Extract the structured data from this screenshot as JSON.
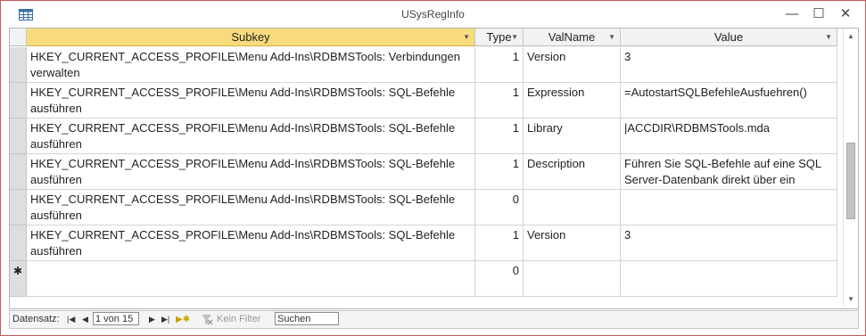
{
  "window": {
    "title": "USysRegInfo",
    "minimize": "—",
    "maximize": "☐",
    "close": "✕"
  },
  "columns": [
    {
      "label": "Subkey",
      "selected": true
    },
    {
      "label": "Type",
      "selected": false
    },
    {
      "label": "ValName",
      "selected": false
    },
    {
      "label": "Value",
      "selected": false
    }
  ],
  "rows": [
    {
      "subkey": "HKEY_CURRENT_ACCESS_PROFILE\\Menu Add-Ins\\RDBMSTools: Verbindungen verwalten",
      "type": "1",
      "valname": "Version",
      "value": "3"
    },
    {
      "subkey": "HKEY_CURRENT_ACCESS_PROFILE\\Menu Add-Ins\\RDBMSTools: SQL-Befehle ausführen",
      "type": "1",
      "valname": "Expression",
      "value": "=AutostartSQLBefehleAusfuehren()"
    },
    {
      "subkey": "HKEY_CURRENT_ACCESS_PROFILE\\Menu Add-Ins\\RDBMSTools: SQL-Befehle ausführen",
      "type": "1",
      "valname": "Library",
      "value": "|ACCDIR\\RDBMSTools.mda"
    },
    {
      "subkey": "HKEY_CURRENT_ACCESS_PROFILE\\Menu Add-Ins\\RDBMSTools: SQL-Befehle ausführen",
      "type": "1",
      "valname": "Description",
      "value": "Führen Sie SQL-Befehle auf eine SQL Server-Datenbank direkt über ein"
    },
    {
      "subkey": "HKEY_CURRENT_ACCESS_PROFILE\\Menu Add-Ins\\RDBMSTools: SQL-Befehle ausführen",
      "type": "0",
      "valname": "",
      "value": ""
    },
    {
      "subkey": "HKEY_CURRENT_ACCESS_PROFILE\\Menu Add-Ins\\RDBMSTools: SQL-Befehle ausführen",
      "type": "1",
      "valname": "Version",
      "value": "3"
    }
  ],
  "new_row": {
    "marker": "✱",
    "type": "0"
  },
  "navigation": {
    "label": "Datensatz:",
    "record": "1 von 15",
    "filter_label": "Kein Filter",
    "search_placeholder": "Suchen"
  }
}
